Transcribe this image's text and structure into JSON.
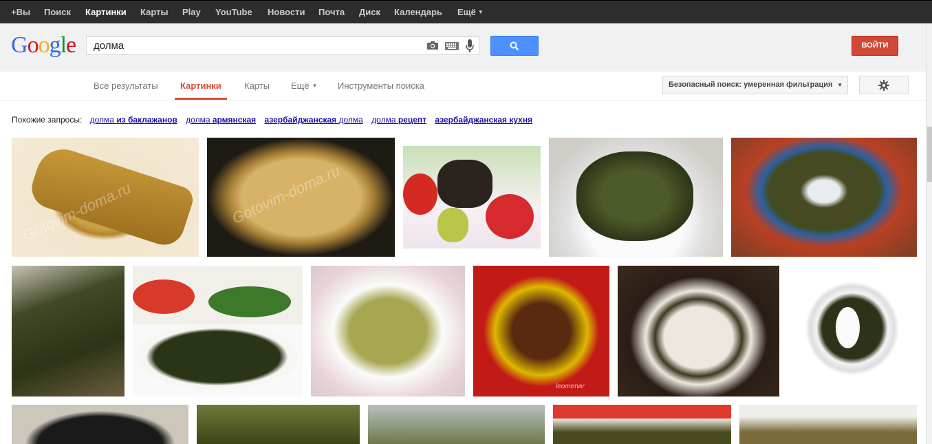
{
  "topbar": {
    "items": [
      {
        "label": "+Вы"
      },
      {
        "label": "Поиск"
      },
      {
        "label": "Картинки"
      },
      {
        "label": "Карты"
      },
      {
        "label": "Play"
      },
      {
        "label": "YouTube"
      },
      {
        "label": "Новости"
      },
      {
        "label": "Почта"
      },
      {
        "label": "Диск"
      },
      {
        "label": "Календарь"
      },
      {
        "label": "Ещё"
      }
    ],
    "active_index": 2
  },
  "header": {
    "logo": [
      "G",
      "o",
      "o",
      "g",
      "l",
      "e"
    ],
    "query": "долма",
    "login_label": "ВОЙТИ",
    "icons": [
      "camera-icon",
      "keyboard-icon",
      "microphone-icon",
      "search-icon"
    ]
  },
  "tabs": {
    "items": [
      {
        "label": "Все результаты"
      },
      {
        "label": "Картинки"
      },
      {
        "label": "Карты"
      },
      {
        "label": "Ещё"
      },
      {
        "label": "Инструменты поиска"
      }
    ],
    "active_index": 1,
    "safesearch_label": "Безопасный поиск: умеренная фильтрация",
    "settings_icon": "gear-icon"
  },
  "related": {
    "label": "Похожие запросы:",
    "links": [
      {
        "plain": "долма ",
        "bold": "из баклажанов"
      },
      {
        "plain": "долма ",
        "bold": "армянская"
      },
      {
        "bold": "азербайджанская ",
        "plain": "долма"
      },
      {
        "plain": "долма ",
        "bold": "рецепт"
      },
      {
        "bold": "азербайджанская кухня",
        "plain": ""
      }
    ]
  },
  "watermarks": {
    "a": "Gotovim-doma.ru",
    "b": "Gotovim-doma.ru",
    "c": "leomenar"
  },
  "colors": {
    "accent_red": "#dd4b39",
    "search_blue": "#4d90fe",
    "link_blue": "#1a0dab",
    "login_red": "#d14836"
  }
}
